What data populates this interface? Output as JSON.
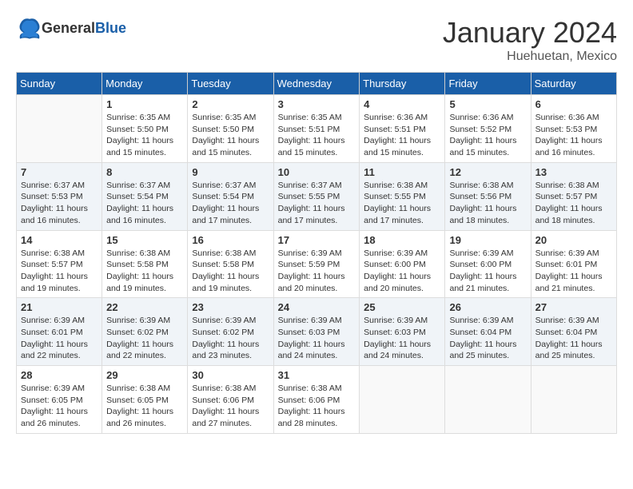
{
  "header": {
    "logo_general": "General",
    "logo_blue": "Blue",
    "month": "January 2024",
    "location": "Huehuetan, Mexico"
  },
  "weekdays": [
    "Sunday",
    "Monday",
    "Tuesday",
    "Wednesday",
    "Thursday",
    "Friday",
    "Saturday"
  ],
  "weeks": [
    [
      {
        "day": "",
        "sunrise": "",
        "sunset": "",
        "daylight": ""
      },
      {
        "day": "1",
        "sunrise": "Sunrise: 6:35 AM",
        "sunset": "Sunset: 5:50 PM",
        "daylight": "Daylight: 11 hours and 15 minutes."
      },
      {
        "day": "2",
        "sunrise": "Sunrise: 6:35 AM",
        "sunset": "Sunset: 5:50 PM",
        "daylight": "Daylight: 11 hours and 15 minutes."
      },
      {
        "day": "3",
        "sunrise": "Sunrise: 6:35 AM",
        "sunset": "Sunset: 5:51 PM",
        "daylight": "Daylight: 11 hours and 15 minutes."
      },
      {
        "day": "4",
        "sunrise": "Sunrise: 6:36 AM",
        "sunset": "Sunset: 5:51 PM",
        "daylight": "Daylight: 11 hours and 15 minutes."
      },
      {
        "day": "5",
        "sunrise": "Sunrise: 6:36 AM",
        "sunset": "Sunset: 5:52 PM",
        "daylight": "Daylight: 11 hours and 15 minutes."
      },
      {
        "day": "6",
        "sunrise": "Sunrise: 6:36 AM",
        "sunset": "Sunset: 5:53 PM",
        "daylight": "Daylight: 11 hours and 16 minutes."
      }
    ],
    [
      {
        "day": "7",
        "sunrise": "Sunrise: 6:37 AM",
        "sunset": "Sunset: 5:53 PM",
        "daylight": "Daylight: 11 hours and 16 minutes."
      },
      {
        "day": "8",
        "sunrise": "Sunrise: 6:37 AM",
        "sunset": "Sunset: 5:54 PM",
        "daylight": "Daylight: 11 hours and 16 minutes."
      },
      {
        "day": "9",
        "sunrise": "Sunrise: 6:37 AM",
        "sunset": "Sunset: 5:54 PM",
        "daylight": "Daylight: 11 hours and 17 minutes."
      },
      {
        "day": "10",
        "sunrise": "Sunrise: 6:37 AM",
        "sunset": "Sunset: 5:55 PM",
        "daylight": "Daylight: 11 hours and 17 minutes."
      },
      {
        "day": "11",
        "sunrise": "Sunrise: 6:38 AM",
        "sunset": "Sunset: 5:55 PM",
        "daylight": "Daylight: 11 hours and 17 minutes."
      },
      {
        "day": "12",
        "sunrise": "Sunrise: 6:38 AM",
        "sunset": "Sunset: 5:56 PM",
        "daylight": "Daylight: 11 hours and 18 minutes."
      },
      {
        "day": "13",
        "sunrise": "Sunrise: 6:38 AM",
        "sunset": "Sunset: 5:57 PM",
        "daylight": "Daylight: 11 hours and 18 minutes."
      }
    ],
    [
      {
        "day": "14",
        "sunrise": "Sunrise: 6:38 AM",
        "sunset": "Sunset: 5:57 PM",
        "daylight": "Daylight: 11 hours and 19 minutes."
      },
      {
        "day": "15",
        "sunrise": "Sunrise: 6:38 AM",
        "sunset": "Sunset: 5:58 PM",
        "daylight": "Daylight: 11 hours and 19 minutes."
      },
      {
        "day": "16",
        "sunrise": "Sunrise: 6:38 AM",
        "sunset": "Sunset: 5:58 PM",
        "daylight": "Daylight: 11 hours and 19 minutes."
      },
      {
        "day": "17",
        "sunrise": "Sunrise: 6:39 AM",
        "sunset": "Sunset: 5:59 PM",
        "daylight": "Daylight: 11 hours and 20 minutes."
      },
      {
        "day": "18",
        "sunrise": "Sunrise: 6:39 AM",
        "sunset": "Sunset: 6:00 PM",
        "daylight": "Daylight: 11 hours and 20 minutes."
      },
      {
        "day": "19",
        "sunrise": "Sunrise: 6:39 AM",
        "sunset": "Sunset: 6:00 PM",
        "daylight": "Daylight: 11 hours and 21 minutes."
      },
      {
        "day": "20",
        "sunrise": "Sunrise: 6:39 AM",
        "sunset": "Sunset: 6:01 PM",
        "daylight": "Daylight: 11 hours and 21 minutes."
      }
    ],
    [
      {
        "day": "21",
        "sunrise": "Sunrise: 6:39 AM",
        "sunset": "Sunset: 6:01 PM",
        "daylight": "Daylight: 11 hours and 22 minutes."
      },
      {
        "day": "22",
        "sunrise": "Sunrise: 6:39 AM",
        "sunset": "Sunset: 6:02 PM",
        "daylight": "Daylight: 11 hours and 22 minutes."
      },
      {
        "day": "23",
        "sunrise": "Sunrise: 6:39 AM",
        "sunset": "Sunset: 6:02 PM",
        "daylight": "Daylight: 11 hours and 23 minutes."
      },
      {
        "day": "24",
        "sunrise": "Sunrise: 6:39 AM",
        "sunset": "Sunset: 6:03 PM",
        "daylight": "Daylight: 11 hours and 24 minutes."
      },
      {
        "day": "25",
        "sunrise": "Sunrise: 6:39 AM",
        "sunset": "Sunset: 6:03 PM",
        "daylight": "Daylight: 11 hours and 24 minutes."
      },
      {
        "day": "26",
        "sunrise": "Sunrise: 6:39 AM",
        "sunset": "Sunset: 6:04 PM",
        "daylight": "Daylight: 11 hours and 25 minutes."
      },
      {
        "day": "27",
        "sunrise": "Sunrise: 6:39 AM",
        "sunset": "Sunset: 6:04 PM",
        "daylight": "Daylight: 11 hours and 25 minutes."
      }
    ],
    [
      {
        "day": "28",
        "sunrise": "Sunrise: 6:39 AM",
        "sunset": "Sunset: 6:05 PM",
        "daylight": "Daylight: 11 hours and 26 minutes."
      },
      {
        "day": "29",
        "sunrise": "Sunrise: 6:38 AM",
        "sunset": "Sunset: 6:05 PM",
        "daylight": "Daylight: 11 hours and 26 minutes."
      },
      {
        "day": "30",
        "sunrise": "Sunrise: 6:38 AM",
        "sunset": "Sunset: 6:06 PM",
        "daylight": "Daylight: 11 hours and 27 minutes."
      },
      {
        "day": "31",
        "sunrise": "Sunrise: 6:38 AM",
        "sunset": "Sunset: 6:06 PM",
        "daylight": "Daylight: 11 hours and 28 minutes."
      },
      {
        "day": "",
        "sunrise": "",
        "sunset": "",
        "daylight": ""
      },
      {
        "day": "",
        "sunrise": "",
        "sunset": "",
        "daylight": ""
      },
      {
        "day": "",
        "sunrise": "",
        "sunset": "",
        "daylight": ""
      }
    ]
  ]
}
